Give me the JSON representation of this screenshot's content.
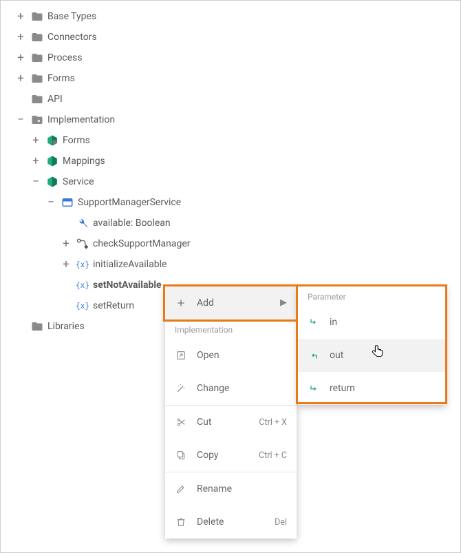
{
  "tree": {
    "baseTypes": "Base Types",
    "connectors": "Connectors",
    "process": "Process",
    "formsTop": "Forms",
    "api": "API",
    "implementation": "Implementation",
    "forms": "Forms",
    "mappings": "Mappings",
    "service": "Service",
    "supportManagerService": "SupportManagerService",
    "available": "available: Boolean",
    "checkSupportManager": "checkSupportManager",
    "initializeAvailable": "initializeAvailable",
    "setNotAvailable": "setNotAvailable",
    "setReturn": "setReturn",
    "libraries": "Libraries"
  },
  "menu": {
    "add": "Add",
    "impl_header": "Implementation",
    "open": "Open",
    "change": "Change",
    "cut": "Cut",
    "cut_shortcut": "Ctrl + X",
    "copy": "Copy",
    "copy_shortcut": "Ctrl + C",
    "rename": "Rename",
    "delete": "Delete",
    "delete_shortcut": "Del"
  },
  "submenu": {
    "header": "Parameter",
    "in": "in",
    "out": "out",
    "return": "return"
  },
  "colors": {
    "folder": "#8a8a8a",
    "package": "#22a97a",
    "service": "#3b78d6",
    "accent": "#ea7a18"
  }
}
